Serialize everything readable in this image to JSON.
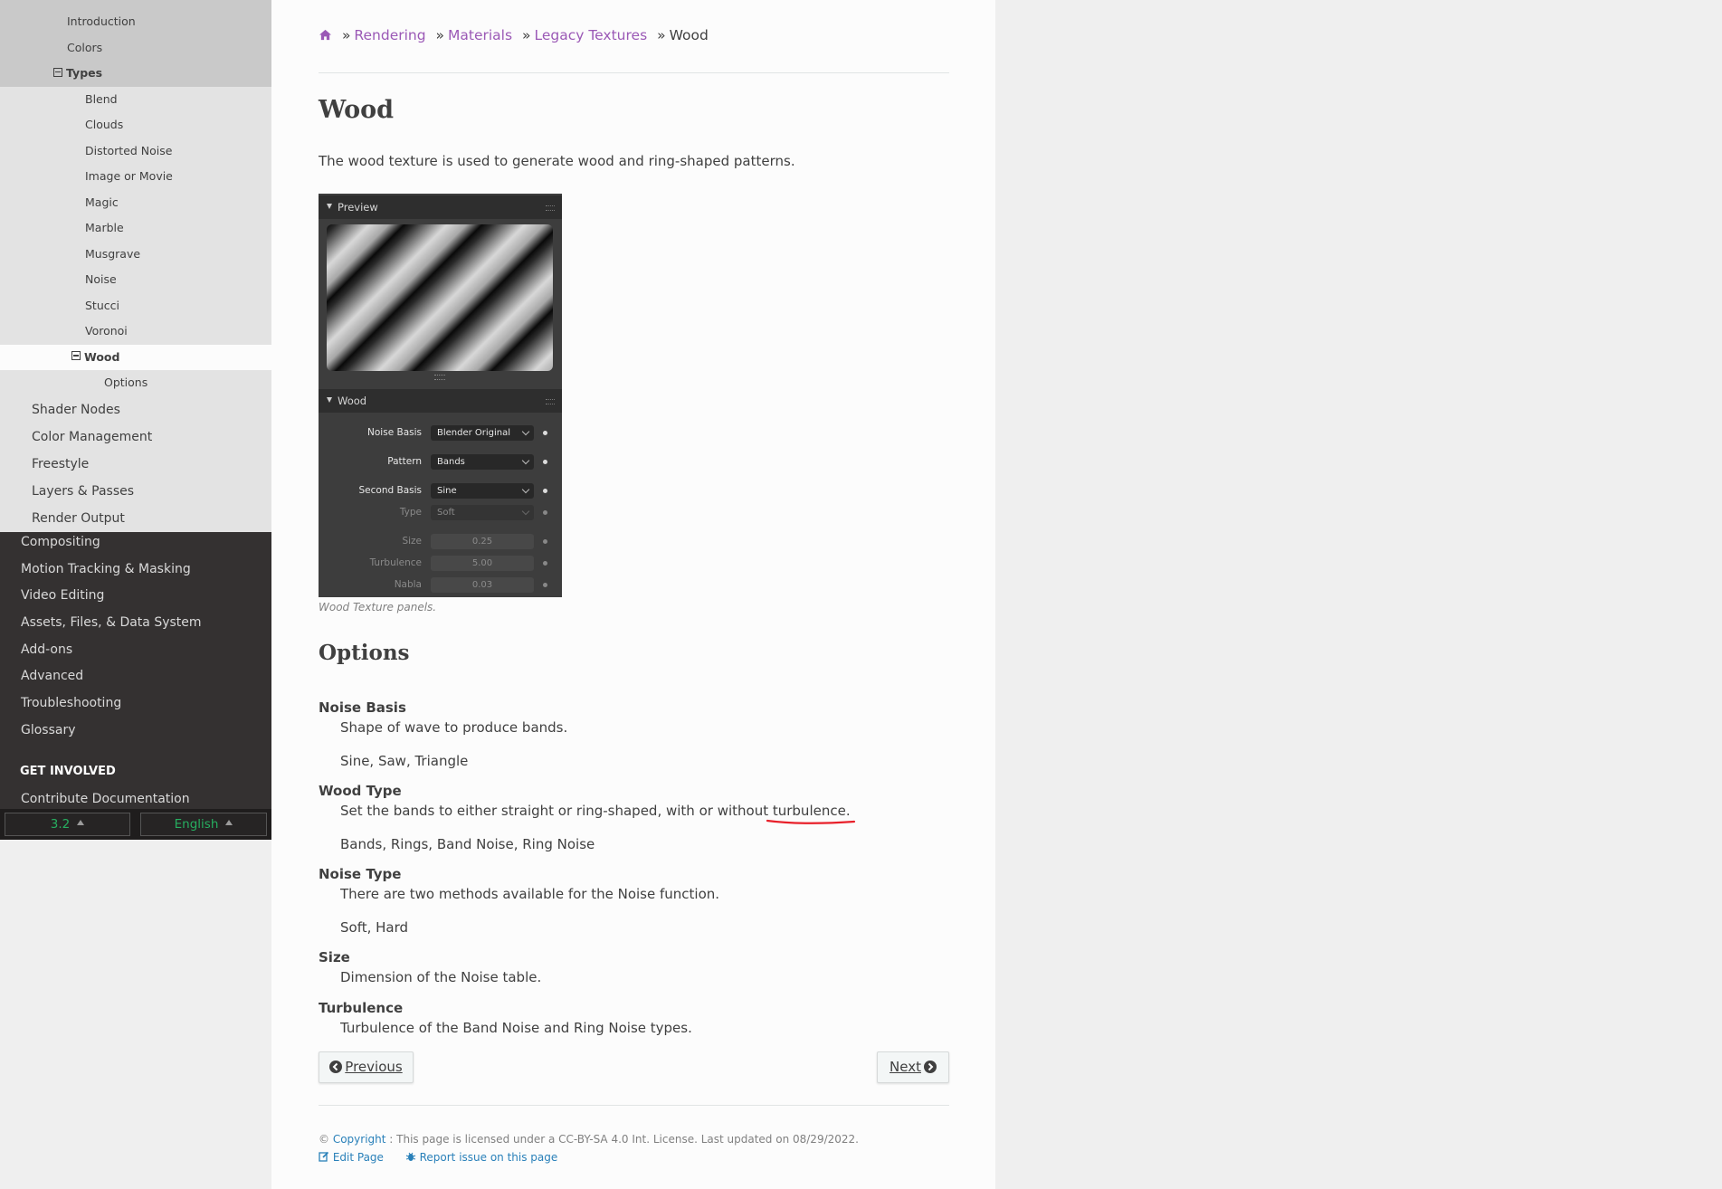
{
  "sidebar": {
    "light_items": [
      {
        "label": "Introduction",
        "indent": 74
      },
      {
        "label": "Colors",
        "indent": 74
      },
      {
        "label": "Types",
        "indent": 74,
        "toggle": true,
        "bold": true
      },
      {
        "label": "Blend",
        "indent": 94
      },
      {
        "label": "Clouds",
        "indent": 94
      },
      {
        "label": "Distorted Noise",
        "indent": 94
      },
      {
        "label": "Image or Movie",
        "indent": 94
      },
      {
        "label": "Magic",
        "indent": 94
      },
      {
        "label": "Marble",
        "indent": 94
      },
      {
        "label": "Musgrave",
        "indent": 94
      },
      {
        "label": "Noise",
        "indent": 94
      },
      {
        "label": "Stucci",
        "indent": 94
      },
      {
        "label": "Voronoi",
        "indent": 94
      },
      {
        "label": "Wood",
        "indent": 94,
        "toggle": true,
        "current": true
      },
      {
        "label": "Options",
        "indent": 115
      }
    ],
    "level1_items": [
      "Shader Nodes",
      "Color Management",
      "Freestyle",
      "Layers & Passes",
      "Render Output"
    ],
    "dark_items": [
      "Compositing",
      "Motion Tracking & Masking",
      "Video Editing",
      "Assets, Files, & Data System",
      "Add-ons",
      "Advanced",
      "Troubleshooting",
      "Glossary"
    ],
    "get_involved": "GET INVOLVED",
    "contribute": "Contribute Documentation",
    "version": "3.2",
    "language": "English"
  },
  "breadcrumb": {
    "home_icon": "home-icon",
    "links": [
      "Rendering",
      "Materials",
      "Legacy Textures"
    ],
    "current": "Wood",
    "sep": "»"
  },
  "page": {
    "title": "Wood",
    "intro": "The wood texture is used to generate wood and ring-shaped patterns.",
    "caption": "Wood Texture panels.",
    "options_heading": "Options"
  },
  "panel": {
    "preview_label": "Preview",
    "wood_label": "Wood",
    "rows": [
      {
        "label": "Noise Basis",
        "value": "Blender Original",
        "kind": "select",
        "dim": false
      },
      {
        "label": "Pattern",
        "value": "Bands",
        "kind": "select",
        "dim": false
      },
      {
        "label": "Second Basis",
        "value": "Sine",
        "kind": "select",
        "dim": false
      },
      {
        "label": "Type",
        "value": "Soft",
        "kind": "select",
        "dim": true
      },
      {
        "label": "Size",
        "value": "0.25",
        "kind": "number",
        "dim": true
      },
      {
        "label": "Turbulence",
        "value": "5.00",
        "kind": "number",
        "dim": true
      },
      {
        "label": "Nabla",
        "value": "0.03",
        "kind": "number",
        "dim": true
      }
    ]
  },
  "options": [
    {
      "term": "Noise Basis",
      "desc": "Shape of wave to produce bands.",
      "values": "Sine, Saw, Triangle"
    },
    {
      "term": "Wood Type",
      "desc_before": "Set the bands to either straight or ring-shaped, with or without ",
      "desc_marked": "turbulence.",
      "values": "Bands, Rings, Band Noise, Ring Noise"
    },
    {
      "term": "Noise Type",
      "desc": "There are two methods available for the Noise function.",
      "values": "Soft, Hard"
    },
    {
      "term": "Size",
      "desc": "Dimension of the Noise table."
    },
    {
      "term": "Turbulence",
      "desc": "Turbulence of the Band Noise and Ring Noise types."
    }
  ],
  "pager": {
    "previous": "Previous",
    "next": "Next"
  },
  "footer": {
    "copyright_symbol": "©",
    "copyright_link": "Copyright",
    "license_text": ": This page is licensed under a CC-BY-SA 4.0 Int. License. Last updated on 08/29/2022.",
    "edit_page": "Edit Page",
    "report_issue": "Report issue on this page"
  },
  "colors": {
    "link_visited": "#9b59b6",
    "link": "#2980b9",
    "accent_green": "#27ae60",
    "annotation": "#e8202a",
    "sidebar_dark": "#343131"
  }
}
